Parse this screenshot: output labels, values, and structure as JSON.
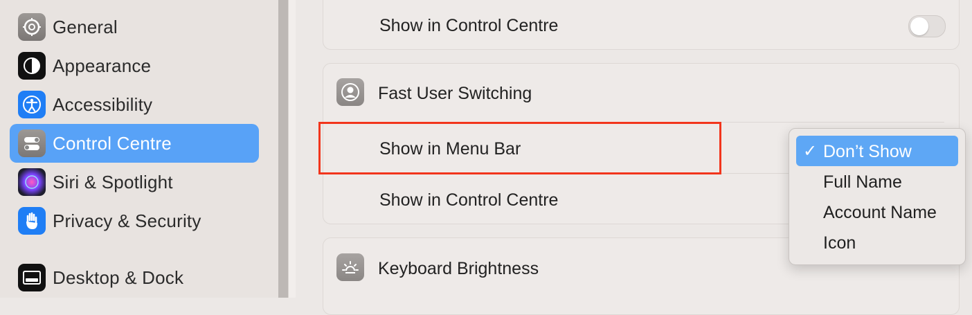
{
  "sidebar": {
    "items": [
      {
        "label": "General",
        "icon": "gear-icon"
      },
      {
        "label": "Appearance",
        "icon": "appearance-icon"
      },
      {
        "label": "Accessibility",
        "icon": "accessibility-icon"
      },
      {
        "label": "Control Centre",
        "icon": "control-centre-icon",
        "selected": true
      },
      {
        "label": "Siri & Spotlight",
        "icon": "siri-icon"
      },
      {
        "label": "Privacy & Security",
        "icon": "hand-icon"
      },
      {
        "label": "Desktop & Dock",
        "icon": "dock-icon"
      }
    ]
  },
  "main": {
    "top_card": {
      "row_label": "Show in Control Centre",
      "toggle_on": false
    },
    "fast_user_switching": {
      "title": "Fast User Switching",
      "icon": "user-icon",
      "menu_bar_label": "Show in Menu Bar",
      "control_centre_label": "Show in Control Centre"
    },
    "keyboard_brightness": {
      "title": "Keyboard Brightness",
      "icon": "brightness-icon"
    }
  },
  "dropdown": {
    "check": "✓",
    "options": [
      "Don’t Show",
      "Full Name",
      "Account Name",
      "Icon"
    ],
    "selected": "Don’t Show"
  },
  "colors": {
    "accent": "#58a2f7",
    "highlight": "#f2351c"
  }
}
